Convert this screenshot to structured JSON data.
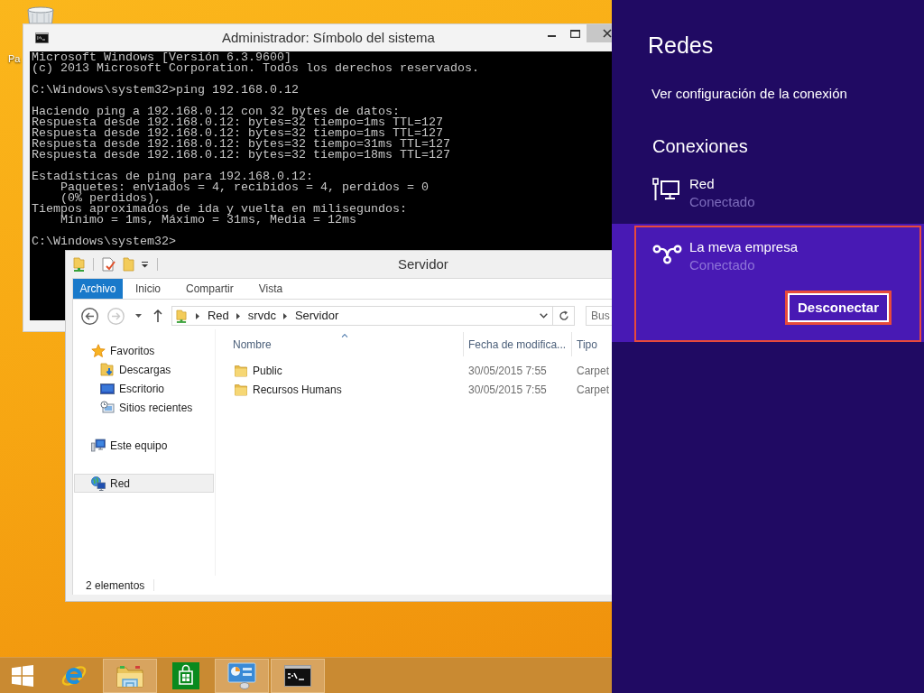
{
  "desktop": {
    "icons": [
      {
        "label": "Pa"
      }
    ]
  },
  "cmd_window": {
    "title": "Administrador: Símbolo del sistema",
    "output": [
      [
        "Microsoft Windows [Versión 6.3.9600]",
        "(c) 2013 Microsoft Corporation. Todos los derechos reservados."
      ],
      [
        "C:\\Windows\\system32>ping 192.168.0.12"
      ],
      [
        "Haciendo ping a 192.168.0.12 con 32 bytes de datos:",
        "Respuesta desde 192.168.0.12: bytes=32 tiempo=1ms TTL=127",
        "Respuesta desde 192.168.0.12: bytes=32 tiempo=1ms TTL=127",
        "Respuesta desde 192.168.0.12: bytes=32 tiempo=31ms TTL=127",
        "Respuesta desde 192.168.0.12: bytes=32 tiempo=18ms TTL=127"
      ],
      [
        "Estadísticas de ping para 192.168.0.12:",
        "    Paquetes: enviados = 4, recibidos = 4, perdidos = 0",
        "    (0% perdidos),",
        "Tiempos aproximados de ida y vuelta en milisegundos:",
        "    Mínimo = 1ms, Máximo = 31ms, Media = 12ms"
      ],
      [
        "C:\\Windows\\system32>"
      ]
    ]
  },
  "explorer_window": {
    "title": "Servidor",
    "ribbon_tabs": [
      {
        "label": "Archivo",
        "kind": "file"
      },
      {
        "label": "Inicio",
        "kind": "tab"
      },
      {
        "label": "Compartir",
        "kind": "tab"
      },
      {
        "label": "Vista",
        "kind": "tab"
      }
    ],
    "back_enabled": true,
    "forward_enabled": false,
    "address": [
      "Red",
      "srvdc",
      "Servidor"
    ],
    "search": {
      "placeholder": "Bus"
    },
    "nav": [
      {
        "label": "Favoritos",
        "selected": false,
        "children": [
          {
            "label": "Descargas",
            "selected": false
          },
          {
            "label": "Escritorio",
            "selected": false
          },
          {
            "label": "Sitios recientes",
            "selected": false
          }
        ]
      },
      {
        "label": "Este equipo",
        "selected": false
      },
      {
        "label": "Red",
        "selected": true
      }
    ],
    "columns": [
      {
        "label": "Nombre",
        "sorted": true
      },
      {
        "label": "Fecha de modifica...",
        "sorted": false
      },
      {
        "label": "Tipo",
        "sorted": false
      }
    ],
    "rows": [
      {
        "name": "Public",
        "modified": "30/05/2015 7:55",
        "type": "Carpet"
      },
      {
        "name": "Recursos Humans",
        "modified": "30/05/2015 7:55",
        "type": "Carpet"
      }
    ],
    "status_bar": "2 elementos"
  },
  "network_panel": {
    "title": "Redes",
    "settings_link": "Ver configuración de la conexión",
    "section_title": "Conexiones",
    "connections": [
      {
        "kind": "wired",
        "name": "Red",
        "status": "Conectado",
        "selected": false,
        "outlined": false
      },
      {
        "kind": "vpn",
        "name": "La meva empresa",
        "status": "Conectado",
        "selected": true,
        "outlined": true,
        "action": {
          "label": "Desconectar",
          "outlined": true
        }
      }
    ]
  },
  "taskbar": {
    "items": [
      {
        "running": false
      },
      {
        "running": false
      },
      {
        "running": true
      },
      {
        "running": false
      },
      {
        "running": true
      },
      {
        "running": true
      }
    ]
  }
}
